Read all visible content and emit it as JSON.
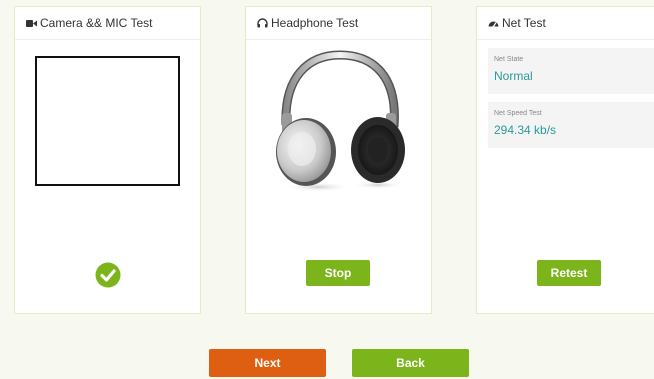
{
  "camera_panel": {
    "title": "Camera && MIC Test",
    "icon": "video-camera-icon"
  },
  "headphone_panel": {
    "title": "Headphone Test",
    "icon": "headphone-icon",
    "button_label": "Stop"
  },
  "net_panel": {
    "title": "Net Test",
    "icon": "dashboard-icon",
    "state_label": "Net State",
    "state_value": "Normal",
    "speed_label": "Net Speed Test",
    "speed_value": "294.34 kb/s",
    "button_label": "Retest"
  },
  "footer": {
    "next_label": "Next",
    "back_label": "Back"
  },
  "colors": {
    "green": "#7cb51b",
    "orange": "#de5f11",
    "teal": "#2a9a9a"
  }
}
